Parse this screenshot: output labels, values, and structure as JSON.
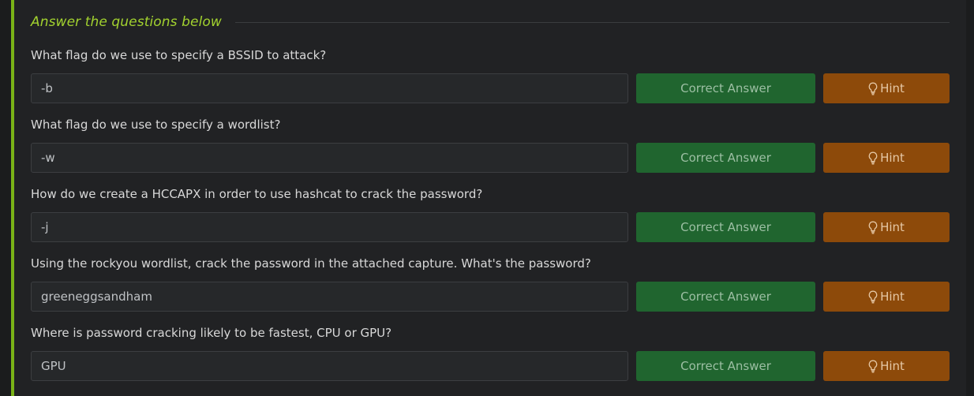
{
  "section": {
    "title": "Answer the questions below"
  },
  "questions": [
    {
      "text": "What flag do we use to specify a BSSID to attack?",
      "answer": "-b",
      "correct_label": "Correct Answer",
      "hint_label": "Hint"
    },
    {
      "text": "What flag do we use to specify a wordlist?",
      "answer": "-w",
      "correct_label": "Correct Answer",
      "hint_label": "Hint"
    },
    {
      "text": "How do we create a HCCAPX in order to use hashcat to crack the password?",
      "answer": "-j",
      "correct_label": "Correct Answer",
      "hint_label": "Hint"
    },
    {
      "text": "Using the rockyou wordlist, crack the password in the attached capture. What's the password?",
      "answer": "greeneggsandham",
      "correct_label": "Correct Answer",
      "hint_label": "Hint"
    },
    {
      "text": "Where is password cracking likely to be fastest, CPU or GPU?",
      "answer": "GPU",
      "correct_label": "Correct Answer",
      "hint_label": "Hint"
    }
  ],
  "icons": {
    "hint": "lightbulb-icon"
  },
  "colors": {
    "accent": "#a2d22f",
    "correct_button": "#20652f",
    "hint_button": "#8d4a0a",
    "left_bar": "#7ab317"
  }
}
